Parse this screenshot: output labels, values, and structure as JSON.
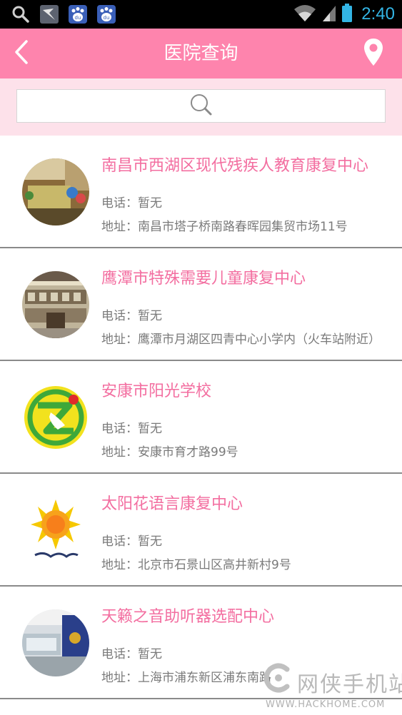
{
  "status_bar": {
    "time": "2:40",
    "left_icons": [
      "search-icon",
      "bird-app-icon",
      "baidu-paw-icon",
      "baidu-paw-icon"
    ],
    "right_icons": [
      "wifi-icon",
      "signal-icon",
      "battery-icon"
    ]
  },
  "header": {
    "title": "医院查询",
    "back_icon": "chevron-left-icon",
    "location_icon": "map-pin-icon",
    "color": "#fe84ad"
  },
  "search": {
    "icon": "search-icon",
    "background": "#fde1ea"
  },
  "hospitals": [
    {
      "name": "南昌市西湖区现代残疾人教育康复中心",
      "phone": "电话：暂无",
      "address": "地址：南昌市塔子桥南路春晖园集贸市场11号"
    },
    {
      "name": "鹰潭市特殊需要儿童康复中心",
      "phone": "电话：暂无",
      "address": "地址：鹰潭市月湖区四青中心小学内（火车站附近）"
    },
    {
      "name": "安康市阳光学校",
      "phone": "电话：暂无",
      "address": "地址：安康市育才路99号"
    },
    {
      "name": "太阳花语言康复中心",
      "phone": "电话：暂无",
      "address": "地址：北京市石景山区高井新村9号"
    },
    {
      "name": "天籁之音助听器选配中心",
      "phone": "电话：暂无",
      "address": "地址：上海市浦东新区浦东南路"
    }
  ],
  "watermark": {
    "text": "网侠手机站",
    "url": "WWW.HACKHOME.COM"
  },
  "colors": {
    "title_pink": "#f36ea0",
    "detail_gray": "#7a7a7a",
    "status_time_blue": "#33b5e5"
  }
}
